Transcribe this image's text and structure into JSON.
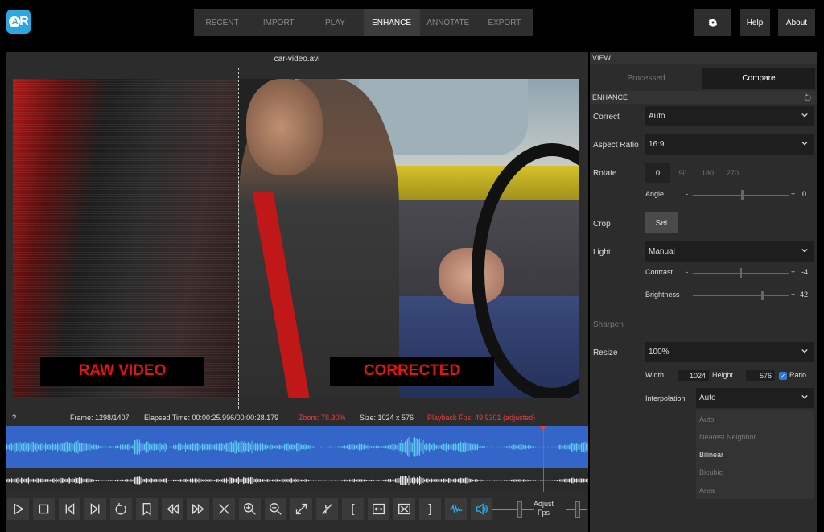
{
  "app": {
    "logo_text": "AR",
    "nav_tabs": [
      "RECENT",
      "IMPORT",
      "PLAY",
      "ENHANCE",
      "ANNOTATE",
      "EXPORT"
    ],
    "active_tab": "ENHANCE",
    "help_label": "Help",
    "about_label": "About",
    "settings_icon": "gear-icon"
  },
  "video": {
    "filename": "car-video.avi",
    "label_left": "RAW VIDEO",
    "label_right": "CORRECTED"
  },
  "status": {
    "question": "?",
    "frame": "Frame: 1298/1407",
    "elapsed": "Elapsed Time: 00:00:25.996/00:00:28.179",
    "zoom": "Zoom: 78.30%",
    "size": "Size: 1024 x 576",
    "fps": "Playback Fps: 49.9301 (adjusted)"
  },
  "controls": {
    "icons": [
      "play-icon",
      "stop-icon",
      "skip-start-icon",
      "skip-end-icon",
      "loop-icon",
      "bookmark-icon",
      "rewind-icon",
      "fast-forward-icon",
      "clear-icon",
      "zoom-in-icon",
      "zoom-out-icon",
      "expand-icon",
      "shrink-icon",
      "mark-in-icon",
      "fit-width-icon",
      "fit-all-icon",
      "mark-out-icon",
      "waveform-icon",
      "volume-icon"
    ],
    "mark_in": "[",
    "mark_out": "]",
    "adjust_label_1": "Adjust",
    "adjust_label_2": "Fps",
    "minus": "-",
    "plus": "+"
  },
  "view": {
    "section_title": "VIEW",
    "tabs": [
      "Processed",
      "Compare"
    ],
    "active": "Compare"
  },
  "enhance": {
    "section_title": "ENHANCE",
    "correct_label": "Correct",
    "correct_value": "Auto",
    "aspect_label": "Aspect Ratio",
    "aspect_value": "16:9",
    "rotate_label": "Rotate",
    "rotate_options": [
      "0",
      "90",
      "180",
      "270"
    ],
    "rotate_active": "0",
    "angle_label": "Angle",
    "angle_minus": "-",
    "angle_plus": "+",
    "angle_value": "0",
    "angle_level": 0.5,
    "crop_label": "Crop",
    "crop_button": "Set",
    "light_label": "Light",
    "light_value": "Manual",
    "contrast_label": "Contrast",
    "contrast_minus": "-",
    "contrast_plus": "+",
    "contrast_value": "-4",
    "contrast_level": 0.48,
    "brightness_label": "Brightness",
    "brightness_minus": "-",
    "brightness_plus": "+",
    "brightness_value": "42",
    "brightness_level": 0.71,
    "sharpen_label": "Sharpen",
    "resize_label": "Resize",
    "resize_value": "100%",
    "width_label": "Width",
    "width_value": "1024",
    "height_label": "Height",
    "height_value": "576",
    "ratio_label": "Ratio",
    "ratio_checked": true,
    "interp_label": "Interpolation",
    "interp_value": "Auto",
    "interp_options": [
      "Auto",
      "Nearest Neighbor",
      "Bilinear",
      "Bicubic",
      "Area"
    ],
    "interp_highlight": "Bilinear"
  }
}
